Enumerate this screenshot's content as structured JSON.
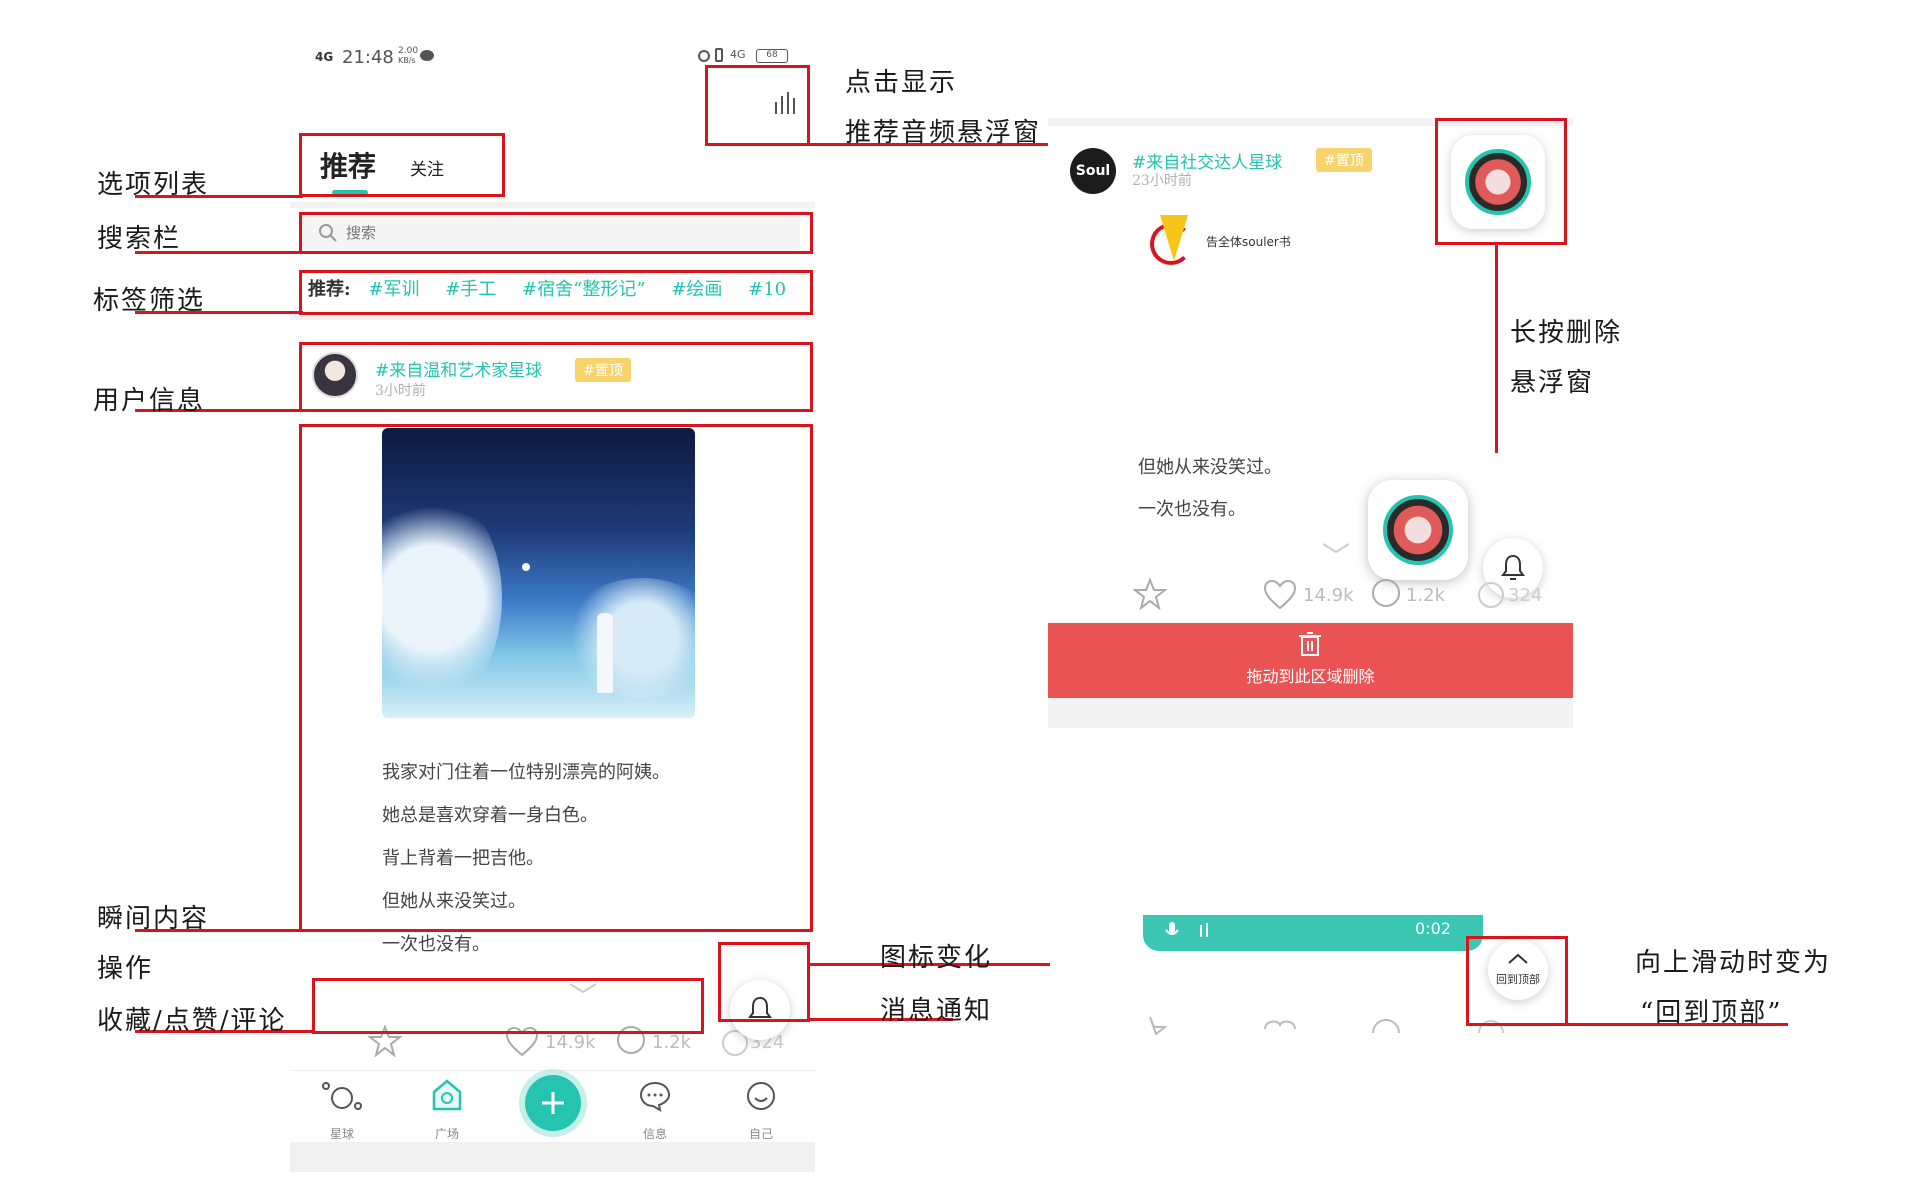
{
  "colors": {
    "accent": "#25c4b0",
    "annotation_red": "#d9141c",
    "delete_red": "#ea5353",
    "pin_yellow": "#f7d36b"
  },
  "status_bar": {
    "network": "4G",
    "time": "21:48",
    "speed_top": "2.00",
    "speed_bottom": "KB/s",
    "right": "4G",
    "battery": "68"
  },
  "left": {
    "tabs": [
      {
        "label": "推荐",
        "active": true
      },
      {
        "label": "关注",
        "active": false
      }
    ],
    "search": {
      "placeholder": "搜索"
    },
    "tag_bar": {
      "prefix": "推荐:",
      "tags": [
        "#军训",
        "#手工",
        "#宿舍“整形记”",
        "#绘画",
        "#10"
      ]
    },
    "user": {
      "planet": "#来自温和艺术家星球",
      "pin": "#置顶",
      "time": "3小时前"
    },
    "post_lines": [
      "我家对门住着一位特别漂亮的阿姨。",
      "她总是喜欢穿着一身白色。",
      "背上背着一把吉他。",
      "但她从来没笑过。",
      "一次也没有。"
    ],
    "actions": {
      "likes": "14.9k",
      "comments": "1.2k",
      "shares": "324"
    },
    "bottom_nav": [
      {
        "label": "星球",
        "icon": "planet-icon"
      },
      {
        "label": "广场",
        "icon": "square-icon"
      },
      {
        "label": "信息",
        "icon": "message-icon"
      },
      {
        "label": "自己",
        "icon": "smile-icon"
      }
    ]
  },
  "right": {
    "avatar_text": "Soul",
    "user": {
      "planet": "#来自社交达人星球",
      "pin": "#置顶",
      "time": "23小时前"
    },
    "banner_text": "告全体souler书",
    "post_lines": [
      "但她从来没笑过。",
      "一次也没有。"
    ],
    "actions": {
      "likes": "14.9k",
      "comments": "1.2k",
      "shares": "324"
    },
    "delete_bar": {
      "label": "拖动到此区域删除"
    },
    "audio_bar": {
      "time": "0:02"
    },
    "back_to_top": "回到顶部"
  },
  "annotations": {
    "tab_list": "选项列表",
    "search_bar": "搜索栏",
    "tag_filter": "标签筛选",
    "user_info": "用户信息",
    "moment_content": "瞬间内容",
    "operations": "操作",
    "operations_detail": "收藏/点赞/评论",
    "click_show": "点击显示",
    "audio_float": "推荐音频悬浮窗",
    "long_press_1": "长按删除",
    "long_press_2": "悬浮窗",
    "icon_change": "图标变化",
    "notification": "消息通知",
    "slide_up_1": "向上滑动时变为",
    "slide_up_2": "“回到顶部”"
  }
}
